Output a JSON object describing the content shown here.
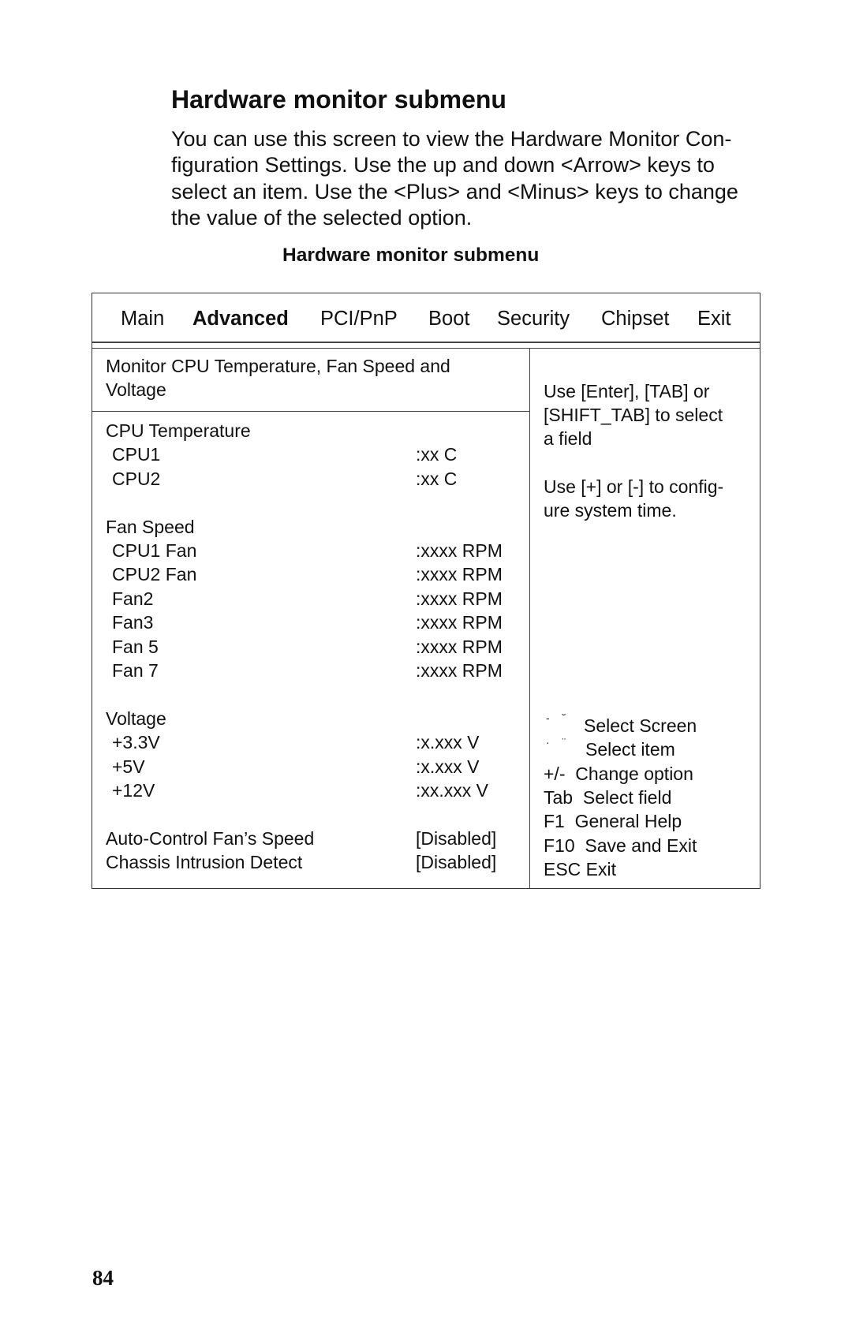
{
  "heading": "Hardware monitor submenu",
  "intro_lines": [
    "You can use this screen to view the Hardware Monitor Con-",
    "figuration Settings. Use the up and down <Arrow> keys to",
    "select an item. Use the <Plus> and <Minus> keys to change",
    "the value of the selected option."
  ],
  "figure_caption": "Hardware monitor submenu",
  "bios": {
    "tabs": [
      {
        "label": "Main",
        "active": false
      },
      {
        "label": "Advanced",
        "active": true
      },
      {
        "label": "PCI/PnP",
        "active": false
      },
      {
        "label": "Boot",
        "active": false
      },
      {
        "label": "Security",
        "active": false
      },
      {
        "label": "Chipset",
        "active": false
      },
      {
        "label": "Exit",
        "active": false
      }
    ],
    "panel_title_lines": [
      "Monitor CPU Temperature, Fan Speed and",
      "Voltage"
    ],
    "sections": [
      {
        "title": "CPU Temperature",
        "items": [
          {
            "label": "CPU1",
            "value": ":xx C"
          },
          {
            "label": "CPU2",
            "value": ":xx C"
          }
        ]
      },
      {
        "title": "Fan Speed",
        "items": [
          {
            "label": "CPU1 Fan",
            "value": ":xxxx RPM"
          },
          {
            "label": "CPU2 Fan",
            "value": ":xxxx RPM"
          },
          {
            "label": "Fan2",
            "value": ":xxxx RPM"
          },
          {
            "label": "Fan3",
            "value": ":xxxx RPM"
          },
          {
            "label": "Fan 5",
            "value": ":xxxx RPM"
          },
          {
            "label": "Fan 7",
            "value": ":xxxx RPM"
          }
        ]
      },
      {
        "title": "Voltage",
        "items": [
          {
            "label": "+3.3V",
            "value": ":x.xxx V"
          },
          {
            "label": "+5V",
            "value": ":x.xxx V"
          },
          {
            "label": "+12V",
            "value": ":xx.xxx V"
          }
        ]
      }
    ],
    "settings": [
      {
        "label": "Auto-Control Fan’s Speed",
        "value": "[Disabled]"
      },
      {
        "label": "Chassis Intrusion Detect",
        "value": "[Disabled]"
      }
    ],
    "help_lines": [
      "Use [Enter], [TAB] or",
      "[SHIFT_TAB] to select",
      "a field",
      "",
      "Use [+] or [-] to config-",
      "ure system time."
    ],
    "key_legend": [
      {
        "key": "left-right-arrows-icon",
        "glyph": "- ˘",
        "desc": "Select Screen"
      },
      {
        "key": "up-down-arrows-icon",
        "glyph": "· ¨",
        "desc": "Select item"
      },
      {
        "key": "",
        "glyph": "",
        "desc": "+/-  Change option"
      },
      {
        "key": "",
        "glyph": "",
        "desc": "Tab  Select field"
      },
      {
        "key": "",
        "glyph": "",
        "desc": "F1  General Help"
      },
      {
        "key": "",
        "glyph": "",
        "desc": "F10  Save and Exit"
      },
      {
        "key": "",
        "glyph": "",
        "desc": "ESC Exit"
      }
    ]
  },
  "page_number": "84"
}
